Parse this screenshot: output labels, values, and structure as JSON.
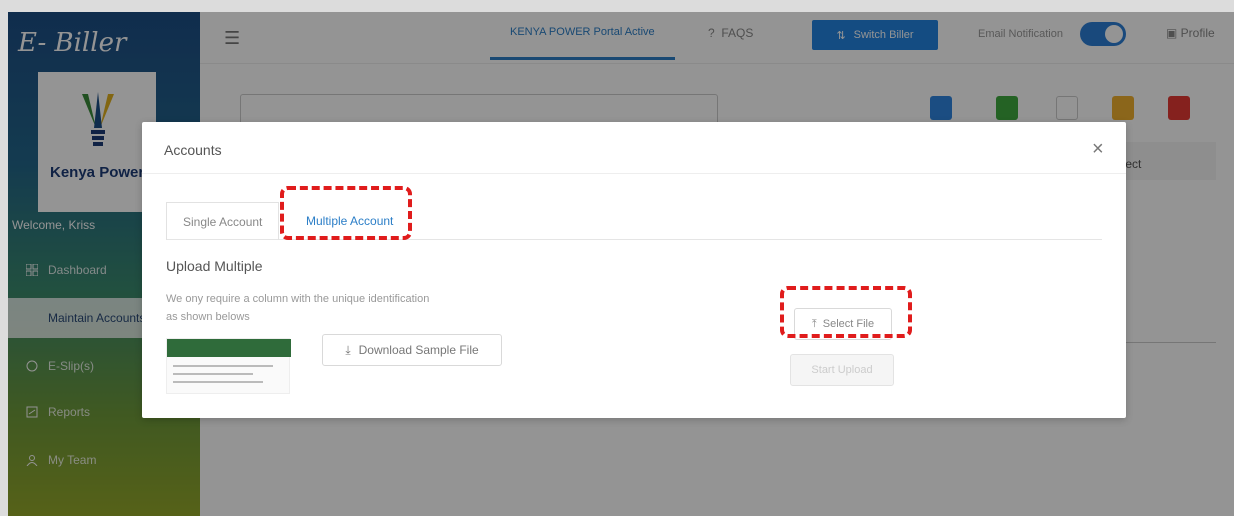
{
  "sidebar": {
    "logo_script": "E- Biller",
    "logo_company": "Kenya Power",
    "welcome": "Welcome, Kriss",
    "items": [
      {
        "label": "Dashboard",
        "icon": "grid-icon"
      },
      {
        "label": "Maintain Accounts",
        "icon": "none"
      },
      {
        "label": "E-Slip(s)",
        "icon": "circle-icon"
      },
      {
        "label": "Reports",
        "icon": "report-icon"
      },
      {
        "label": "My Team",
        "icon": "team-icon"
      }
    ]
  },
  "topbar": {
    "portal_tab": "KENYA POWER Portal Active",
    "faqs": "FAQS",
    "switch_biller": "Switch Biller",
    "email_notification": "Email Notification",
    "profile": "Profile"
  },
  "background": {
    "search_placeholder": "",
    "table_header": "elect",
    "action_colors": [
      "#2f86e0",
      "#3faa3f",
      "#ffffff",
      "#f0b030",
      "#e53935"
    ]
  },
  "modal": {
    "title": "Accounts",
    "close": "×",
    "tabs": [
      {
        "label": "Single Account",
        "active": false
      },
      {
        "label": "Multiple Account",
        "active": true
      }
    ],
    "upload_title": "Upload Multiple",
    "upload_desc": "We ony require a column with the unique identification as shown belows",
    "download_label": "Download Sample File",
    "select_file_label": "Select File",
    "start_upload_label": "Start Upload"
  },
  "colors": {
    "accent": "#2b7ec7",
    "highlight": "#e01c1c"
  }
}
